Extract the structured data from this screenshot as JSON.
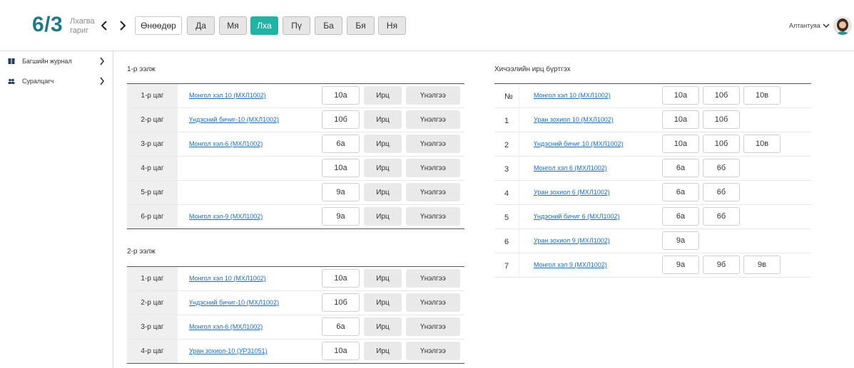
{
  "header": {
    "date": "6/3",
    "weekday_line1": "Лхагва",
    "weekday_line2": "гариг",
    "today_label": "Өнөөдөр",
    "days": [
      {
        "label": "Да",
        "active": false
      },
      {
        "label": "Мя",
        "active": false
      },
      {
        "label": "Лха",
        "active": true
      },
      {
        "label": "Пү",
        "active": false
      },
      {
        "label": "Ба",
        "active": false
      },
      {
        "label": "Бя",
        "active": false
      },
      {
        "label": "Ня",
        "active": false
      }
    ],
    "user_name": "Алтантуяа"
  },
  "sidebar": {
    "items": [
      {
        "label": "Багшийн журнал",
        "icon": "book-icon"
      },
      {
        "label": "Суралцагч",
        "icon": "users-icon"
      }
    ]
  },
  "shift1": {
    "title": "1-р ээлж",
    "rows": [
      {
        "period": "1-р цаг",
        "lesson": "Монгол хэл 10 (МХЛ1002)",
        "class": "10а",
        "attendance": "Ирц",
        "assessment": "Үнэлгээ"
      },
      {
        "period": "2-р цаг",
        "lesson": "Үндэсний бичиг-10 (МХЛ1002)",
        "class": "10б",
        "attendance": "Ирц",
        "assessment": "Үнэлгээ"
      },
      {
        "period": "3-р цаг",
        "lesson": "Монгол хэл-6 (МХЛ1002)",
        "class": "6а",
        "attendance": "Ирц",
        "assessment": "Үнэлгээ"
      },
      {
        "period": "4-р цаг",
        "lesson": "",
        "class": "10а",
        "attendance": "Ирц",
        "assessment": "Үнэлгээ"
      },
      {
        "period": "5-р цаг",
        "lesson": "",
        "class": "9а",
        "attendance": "Ирц",
        "assessment": "Үнэлгээ"
      },
      {
        "period": "6-р цаг",
        "lesson": "Монгол хэл-9 (МХЛ1002)",
        "class": "9а",
        "attendance": "Ирц",
        "assessment": "Үнэлгээ"
      }
    ]
  },
  "shift2": {
    "title": "2-р ээлж",
    "rows": [
      {
        "period": "1-р цаг",
        "lesson": "Монгол хэл 10 (МХЛ1002)",
        "class": "10а",
        "attendance": "Ирц",
        "assessment": "Үнэлгээ"
      },
      {
        "period": "2-р цаг",
        "lesson": "Үндэсний бичиг-10 (МХЛ1002)",
        "class": "10б",
        "attendance": "Ирц",
        "assessment": "Үнэлгээ"
      },
      {
        "period": "3-р цаг",
        "lesson": "Монгол хэл-6 (МХЛ1002)",
        "class": "6а",
        "attendance": "Ирц",
        "assessment": "Үнэлгээ"
      },
      {
        "period": "4-р цаг",
        "lesson": "Уран зохиол-10 (УР31051)",
        "class": "10а",
        "attendance": "Ирц",
        "assessment": "Үнэлгээ"
      }
    ]
  },
  "register": {
    "title": "Хичээлийн ирц бүртгэх",
    "header_num": "№",
    "rows": [
      {
        "num": "",
        "lesson": "Монгол хэл 10 (МХЛ1002)",
        "classes": [
          "10а",
          "10б",
          "10в"
        ]
      },
      {
        "num": "1",
        "lesson": "Уран зохиол 10 (МХЛ1002)",
        "classes": [
          "10а",
          "10б"
        ]
      },
      {
        "num": "2",
        "lesson": "Үндэсний бичиг 10 (МХЛ1002)",
        "classes": [
          "10а",
          "10б",
          "10в"
        ]
      },
      {
        "num": "3",
        "lesson": "Монгол хэл 6 (МХЛ1002)",
        "classes": [
          "6а",
          "6б"
        ]
      },
      {
        "num": "4",
        "lesson": "Уран зохиол 6 (МХЛ1002)",
        "classes": [
          "6а",
          "6б"
        ]
      },
      {
        "num": "5",
        "lesson": "Үндэсний бичиг 6 (МХЛ1002)",
        "classes": [
          "6а",
          "6б"
        ]
      },
      {
        "num": "6",
        "lesson": "Уран зохиол 9 (МХЛ1002)",
        "classes": [
          "9а"
        ]
      },
      {
        "num": "7",
        "lesson": "Монгол хэл 9 (МХЛ1002)",
        "classes": [
          "9а",
          "9б",
          "9в"
        ]
      }
    ]
  },
  "colors": {
    "brand": "#1e7b86",
    "active_day": "#22b3a5",
    "link": "#1a6fc4"
  }
}
